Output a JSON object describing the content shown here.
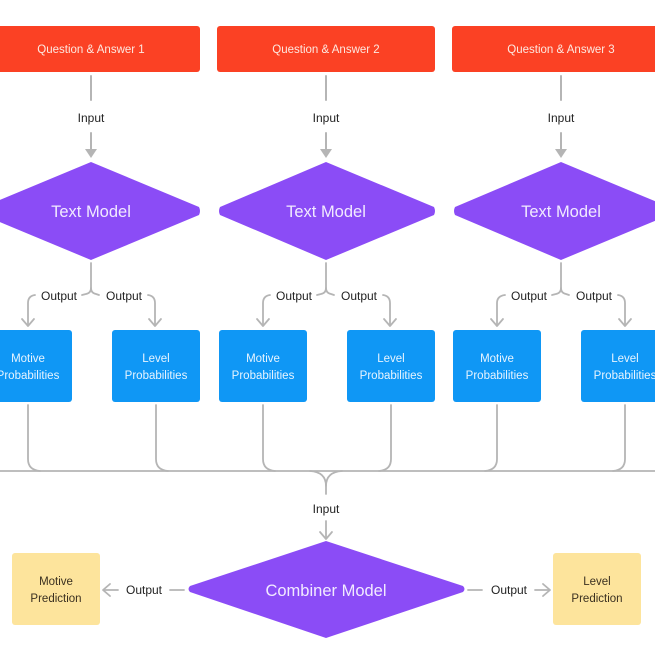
{
  "colors": {
    "qa_fill": "#fb4124",
    "model_fill": "#8b4cf6",
    "prob_fill": "#0f97f5",
    "pred_fill": "#fde49c",
    "connector": "#b5b5b5"
  },
  "labels": {
    "input": "Input",
    "output": "Output"
  },
  "pipelines": [
    {
      "source": "Question & Answer 1",
      "model": "Text Model",
      "outputs": [
        {
          "line1": "Motive",
          "line2": "Probabilities"
        },
        {
          "line1": "Level",
          "line2": "Probabilities"
        }
      ]
    },
    {
      "source": "Question & Answer 2",
      "model": "Text Model",
      "outputs": [
        {
          "line1": "Motive",
          "line2": "Probabilities"
        },
        {
          "line1": "Level",
          "line2": "Probabilities"
        }
      ]
    },
    {
      "source": "Question & Answer 3",
      "model": "Text Model",
      "outputs": [
        {
          "line1": "Motive",
          "line2": "Probabilities"
        },
        {
          "line1": "Level",
          "line2": "Probabilities"
        }
      ]
    }
  ],
  "combiner": {
    "model": "Combiner Model",
    "left_output": {
      "line1": "Motive",
      "line2": "Prediction"
    },
    "right_output": {
      "line1": "Level",
      "line2": "Prediction"
    }
  }
}
